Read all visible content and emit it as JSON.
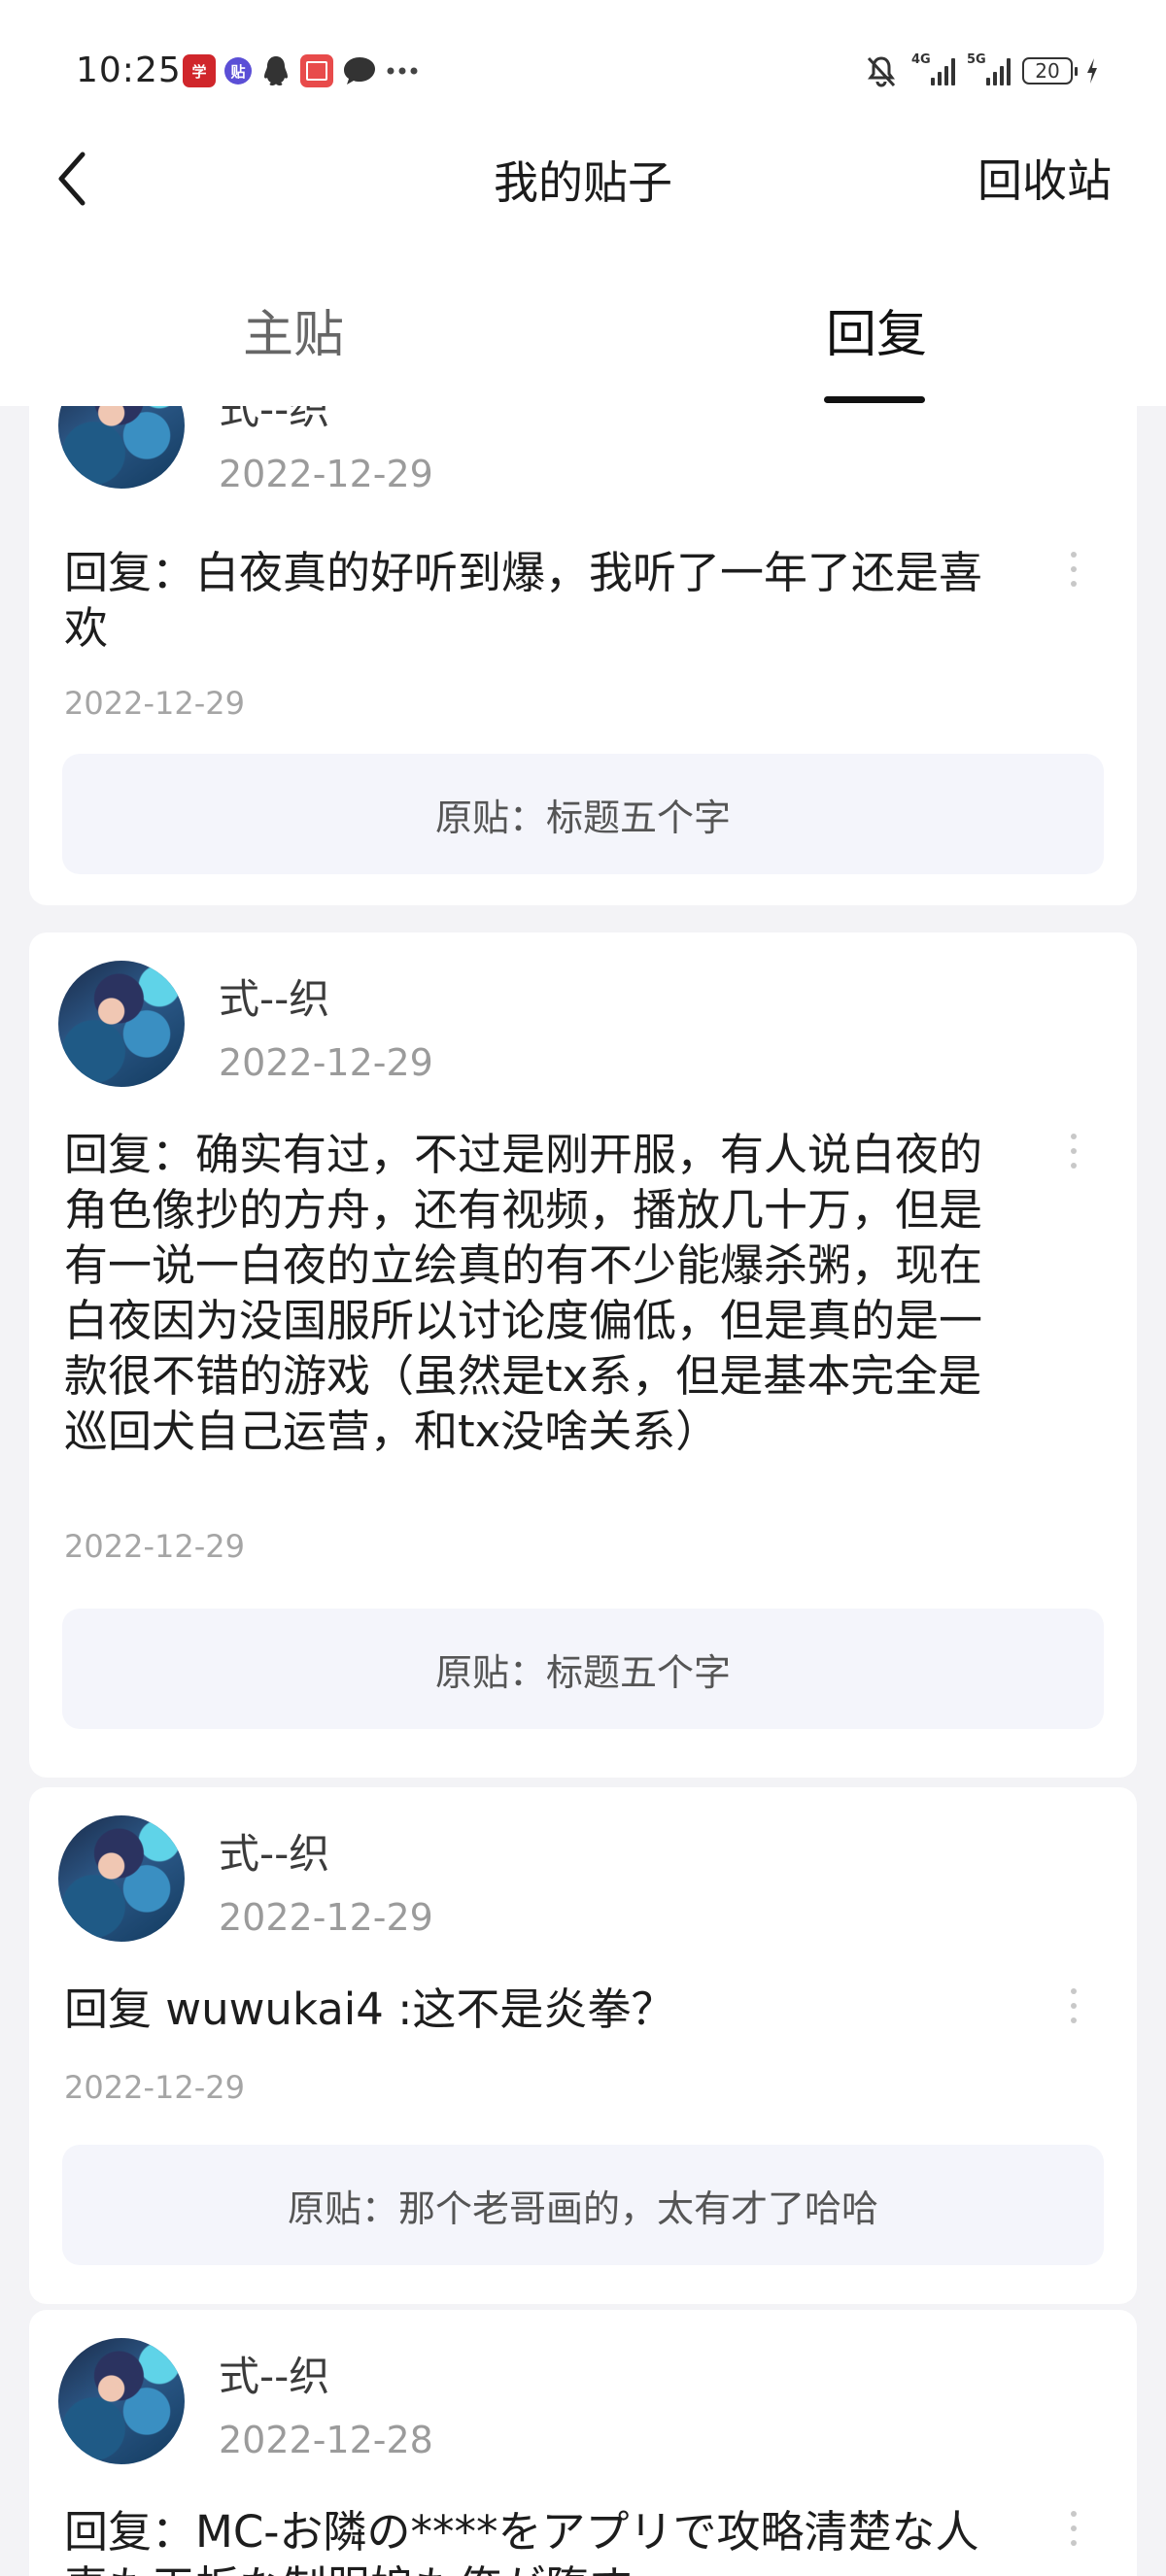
{
  "status_bar": {
    "time": "10:25",
    "battery": "20",
    "network_1": "4G",
    "network_2": "5G",
    "notification_icons": [
      "xuexi-app-icon",
      "tieba-app-icon",
      "qq-icon",
      "red-book-icon",
      "chat-bubble-icon",
      "more-notifications-icon"
    ],
    "right_icons": [
      "bell-muted-icon",
      "signal-4g-icon",
      "signal-5g-icon",
      "battery-icon",
      "charging-icon"
    ]
  },
  "nav": {
    "back_icon": "chevron-left-icon",
    "title": "我的贴子",
    "recycle": "回收站"
  },
  "tabs": [
    {
      "label": "主贴",
      "active": false
    },
    {
      "label": "回复",
      "active": true
    }
  ],
  "posts": [
    {
      "author": "式--织",
      "date": "2022-12-29",
      "reply": "回复：白夜真的好听到爆，我听了一年了还是喜欢",
      "reply_date": "2022-12-29",
      "original": "原贴：标题五个字"
    },
    {
      "author": "式--织",
      "date": "2022-12-29",
      "reply": "回复：确实有过，不过是刚开服，有人说白夜的角色像抄的方舟，还有视频，播放几十万，但是有一说一白夜的立绘真的有不少能爆杀粥，现在白夜因为没国服所以讨论度偏低，但是真的是一款很不错的游戏（虽然是tx系，但是基本完全是巡回犬自己运营，和tx没啥关系）",
      "reply_date": "2022-12-29",
      "original": "原贴：标题五个字"
    },
    {
      "author": "式--织",
      "date": "2022-12-29",
      "reply": "回复 wuwukai4 :这不是炎拳？",
      "reply_date": "2022-12-29",
      "original": "原贴：那个老哥画的，太有才了哈哈"
    },
    {
      "author": "式--织",
      "date": "2022-12-28",
      "reply": "回复：MC-お隣の****をアプリで攻略清楚な人妻も天板な制服娘も俺が堕す",
      "reply_date": "",
      "original": ""
    }
  ],
  "colors": {
    "background": "#f3f3f6",
    "card": "#ffffff",
    "original_box": "#f4f5fb",
    "muted_text": "#9b9b9b",
    "active_tab": "#111111"
  }
}
